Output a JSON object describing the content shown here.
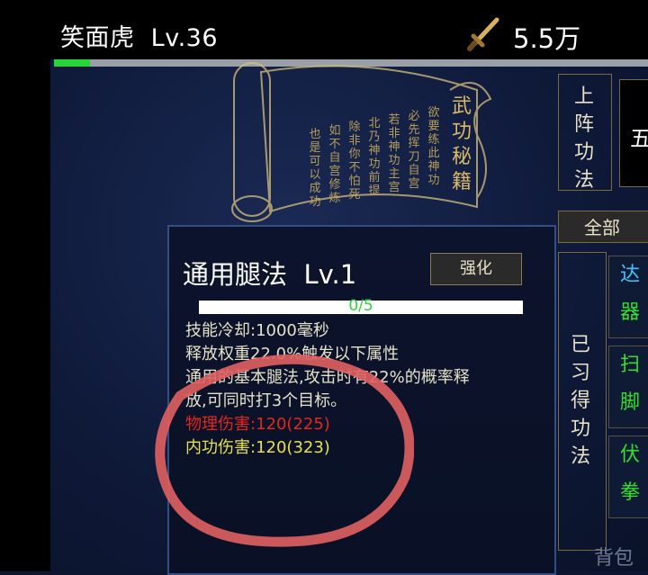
{
  "player": {
    "name": "笑面虎",
    "level": "Lv.36",
    "power": "5.5万",
    "exp_fraction": 0.06
  },
  "scroll": {
    "title": "武功秘籍",
    "columns": [
      "欲要练此神功",
      "必先挥刀自宫",
      "若非神功主宫",
      "北乃神功前提",
      "除非你不怕死",
      "如不自宫修炼",
      "也是可以成功"
    ]
  },
  "sidebar": {
    "deploy_label": [
      "上",
      "阵",
      "功",
      "法"
    ],
    "deploy_value": "五",
    "all_tab": "全部",
    "learned_label": [
      "已",
      "习",
      "得",
      "功",
      "法"
    ]
  },
  "skill": {
    "name": "通用腿法",
    "level": "Lv.1",
    "enhance_label": "强化",
    "progress": "0/5",
    "progress_fraction": 0,
    "cooldown": "技能冷却:1000毫秒",
    "weight": "释放权重22.0%触发以下属性",
    "effect_line1": "通用的基本腿法,攻击时有22%的概率释",
    "effect_line2": "放,可同时打3个目标。",
    "physical_damage": "物理伤害:120(225)",
    "inner_damage": "内功伤害:120(323)"
  },
  "skill_list": [
    {
      "title": "达",
      "subtitle": "器"
    },
    {
      "title": "扫",
      "subtitle": "脚"
    },
    {
      "title": "伏",
      "subtitle": "拳"
    }
  ],
  "bag_label": "背包",
  "colors": {
    "title_cyan": "#3cc4ff",
    "title_green": "#2fe02f",
    "red_text": "#e3271d",
    "yellow_text": "#e8e04a"
  }
}
